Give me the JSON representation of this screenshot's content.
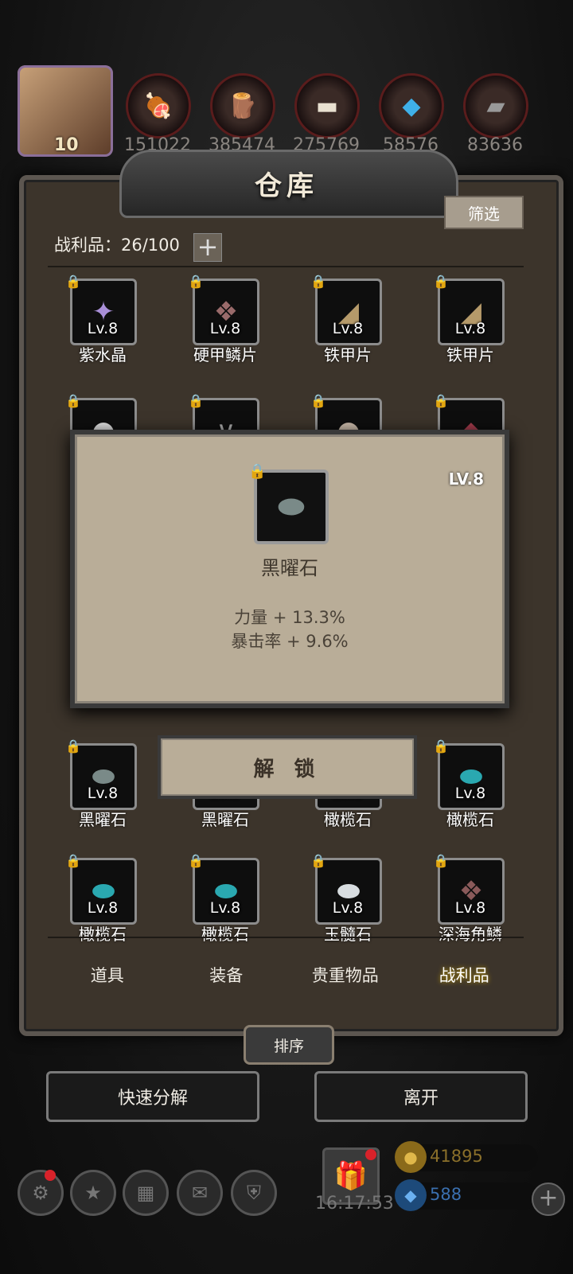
{
  "player": {
    "level": "10"
  },
  "resources": [
    {
      "icon": "meat-icon",
      "value": "151022"
    },
    {
      "icon": "wood-icon",
      "value": "385474"
    },
    {
      "icon": "iron-icon",
      "value": "275769"
    },
    {
      "icon": "crystal-icon",
      "value": "58576"
    },
    {
      "icon": "stone-icon",
      "value": "83636"
    }
  ],
  "window": {
    "title": "仓库",
    "filter_label": "筛选",
    "count_label": "战利品：26/100",
    "add_label": "+"
  },
  "items": [
    {
      "level": "Lv.8",
      "name": "紫水晶",
      "icon": "💎"
    },
    {
      "level": "Lv.8",
      "name": "硬甲鳞片",
      "icon": "🪶"
    },
    {
      "level": "Lv.8",
      "name": "铁甲片",
      "icon": "🪨"
    },
    {
      "level": "Lv.8",
      "name": "铁甲片",
      "icon": "🪨"
    },
    {
      "level": "Lv.8",
      "name": "黑曜石",
      "icon": "🪨"
    },
    {
      "level": "Lv.8",
      "name": "黑曜石",
      "icon": "🪨"
    },
    {
      "level": "Lv.8",
      "name": "橄榄石",
      "icon": "🟢"
    },
    {
      "level": "Lv.8",
      "name": "橄榄石",
      "icon": "🟢"
    },
    {
      "level": "Lv.8",
      "name": "橄榄石",
      "icon": "🟢"
    },
    {
      "level": "Lv.8",
      "name": "橄榄石",
      "icon": "🟢"
    },
    {
      "level": "Lv.8",
      "name": "玉髓石",
      "icon": "⚪"
    },
    {
      "level": "Lv.8",
      "name": "深海角鳞",
      "icon": "🪶"
    }
  ],
  "popup": {
    "level": "LV.8",
    "name": "黑曜石",
    "stats": [
      "力量 + 13.3%",
      "暴击率 + 9.6%"
    ],
    "unlock_label": "解 锁"
  },
  "tabs": [
    "道具",
    "装备",
    "贵重物品",
    "战利品"
  ],
  "active_tab": "战利品",
  "sort_label": "排序",
  "actions": {
    "quick_decompose": "快速分解",
    "leave": "离开"
  },
  "bottom": {
    "clock": "16:17:53",
    "gold": "41895",
    "gems": "588"
  },
  "colors": {
    "gold": "#c9a227",
    "gem": "#3a7fd0",
    "frame": "#3c342b",
    "popup": "#b9ad98"
  }
}
